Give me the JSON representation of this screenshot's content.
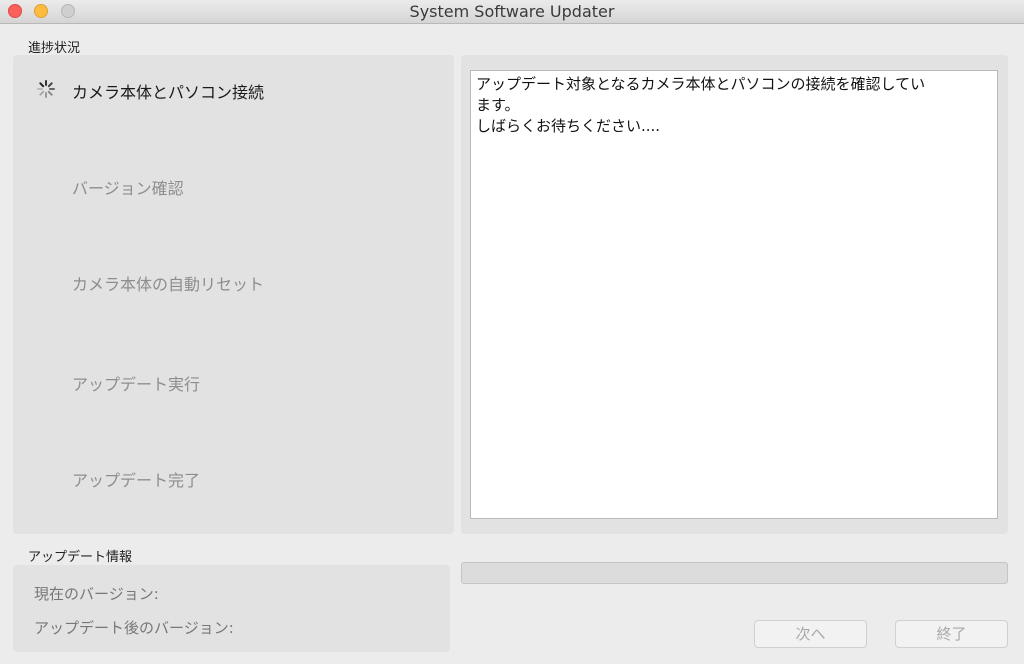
{
  "window": {
    "title": "System Software Updater"
  },
  "progress_section": {
    "label": "進捗状況",
    "steps": [
      {
        "label": "カメラ本体とパソコン接続",
        "state": "active"
      },
      {
        "label": "バージョン確認",
        "state": "pending"
      },
      {
        "label": "カメラ本体の自動リセット",
        "state": "pending"
      },
      {
        "label": "アップデート実行",
        "state": "pending"
      },
      {
        "label": "アップデート完了",
        "state": "pending"
      }
    ]
  },
  "message": {
    "lines": [
      "アップデート対象となるカメラ本体とパソコンの接続を確認してい",
      "ます。",
      "しばらくお待ちください...."
    ]
  },
  "update_info": {
    "label": "アップデート情報",
    "current_version_label": "現在のバージョン:",
    "updated_version_label": "アップデート後のバージョン:"
  },
  "progress_bar": {
    "value": 0
  },
  "buttons": {
    "next_label": "次へ",
    "quit_label": "終了"
  },
  "colors": {
    "active_text": "#1a1a1a",
    "inactive_text": "#8d8d8d",
    "panel": "#e2e2e2"
  }
}
